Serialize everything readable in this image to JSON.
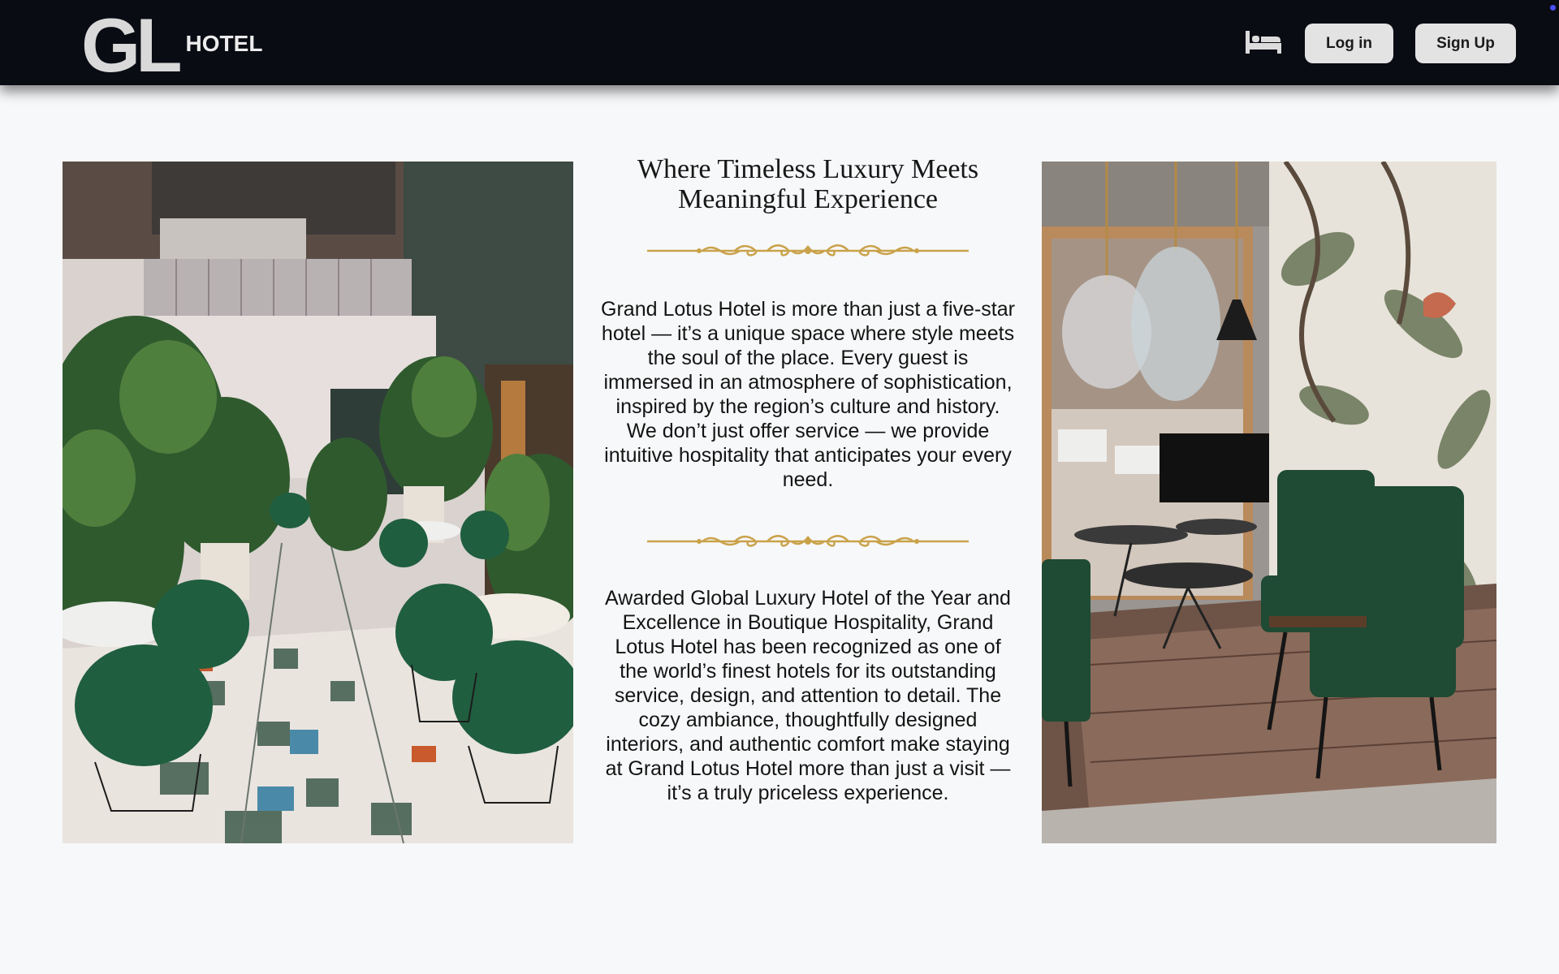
{
  "header": {
    "logo_mark": "GL",
    "logo_word": "HOTEL",
    "bed_icon": "bed-icon",
    "login_label": "Log in",
    "signup_label": "Sign Up"
  },
  "images": {
    "left": "hotel-atrium-courtyard-photo",
    "right": "hotel-lounge-interior-photo"
  },
  "content": {
    "headline_line1": "Where Timeless Luxury Meets",
    "headline_line2": "Meaningful Experience",
    "ornament_icon": "gold-flourish-divider",
    "paragraph1": "Grand Lotus Hotel is more than just a five-star hotel — it’s a unique space where style meets the soul of the place. Every guest is immersed in an atmosphere of sophistication, inspired by the region’s culture and history. We don’t just offer service — we provide intuitive hospitality that anticipates your every need.",
    "paragraph2": "Awarded Global Luxury Hotel of the Year and Excellence in Boutique Hospitality, Grand Lotus Hotel has been recognized as one of the world’s finest hotels for its outstanding service, design, and attention to detail. The cozy ambiance, thoughtfully designed interiors, and authentic comfort make staying at Grand Lotus Hotel more than just a visit — it’s a truly priceless experience."
  },
  "colors": {
    "navbar": "#0a0c14",
    "page_background": "#f7f8f9",
    "button_background": "#e3e3e3",
    "ornament_gold": "#c9a24a"
  }
}
